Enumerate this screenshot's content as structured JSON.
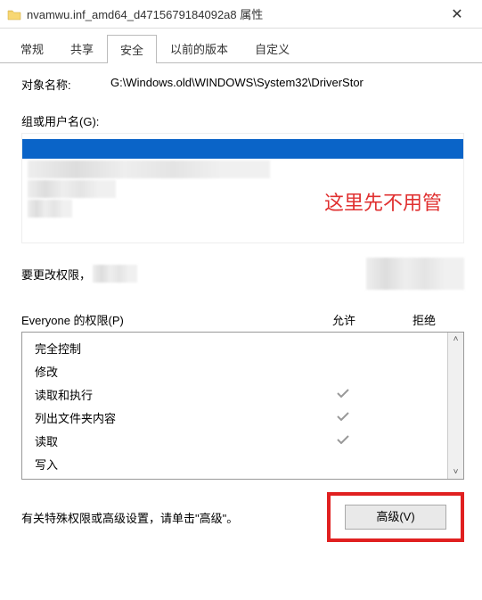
{
  "titlebar": {
    "title": "nvamwu.inf_amd64_d4715679184092a8 属性",
    "close": "✕"
  },
  "tabs": {
    "general": "常规",
    "share": "共享",
    "security": "安全",
    "previous": "以前的版本",
    "custom": "自定义"
  },
  "object": {
    "label": "对象名称:",
    "value": "G:\\Windows.old\\WINDOWS\\System32\\DriverStor"
  },
  "groups": {
    "label": "组或用户名(G):"
  },
  "annotation": "这里先不用管",
  "change": {
    "text": "要更改权限，"
  },
  "perm_header": {
    "name": "Everyone 的权限(P)",
    "allow": "允许",
    "deny": "拒绝"
  },
  "perms": {
    "p0": "完全控制",
    "p1": "修改",
    "p2": "读取和执行",
    "p3": "列出文件夹内容",
    "p4": "读取",
    "p5": "写入"
  },
  "advanced": {
    "text": "有关特殊权限或高级设置，请单击\"高级\"。",
    "button": "高级(V)"
  }
}
